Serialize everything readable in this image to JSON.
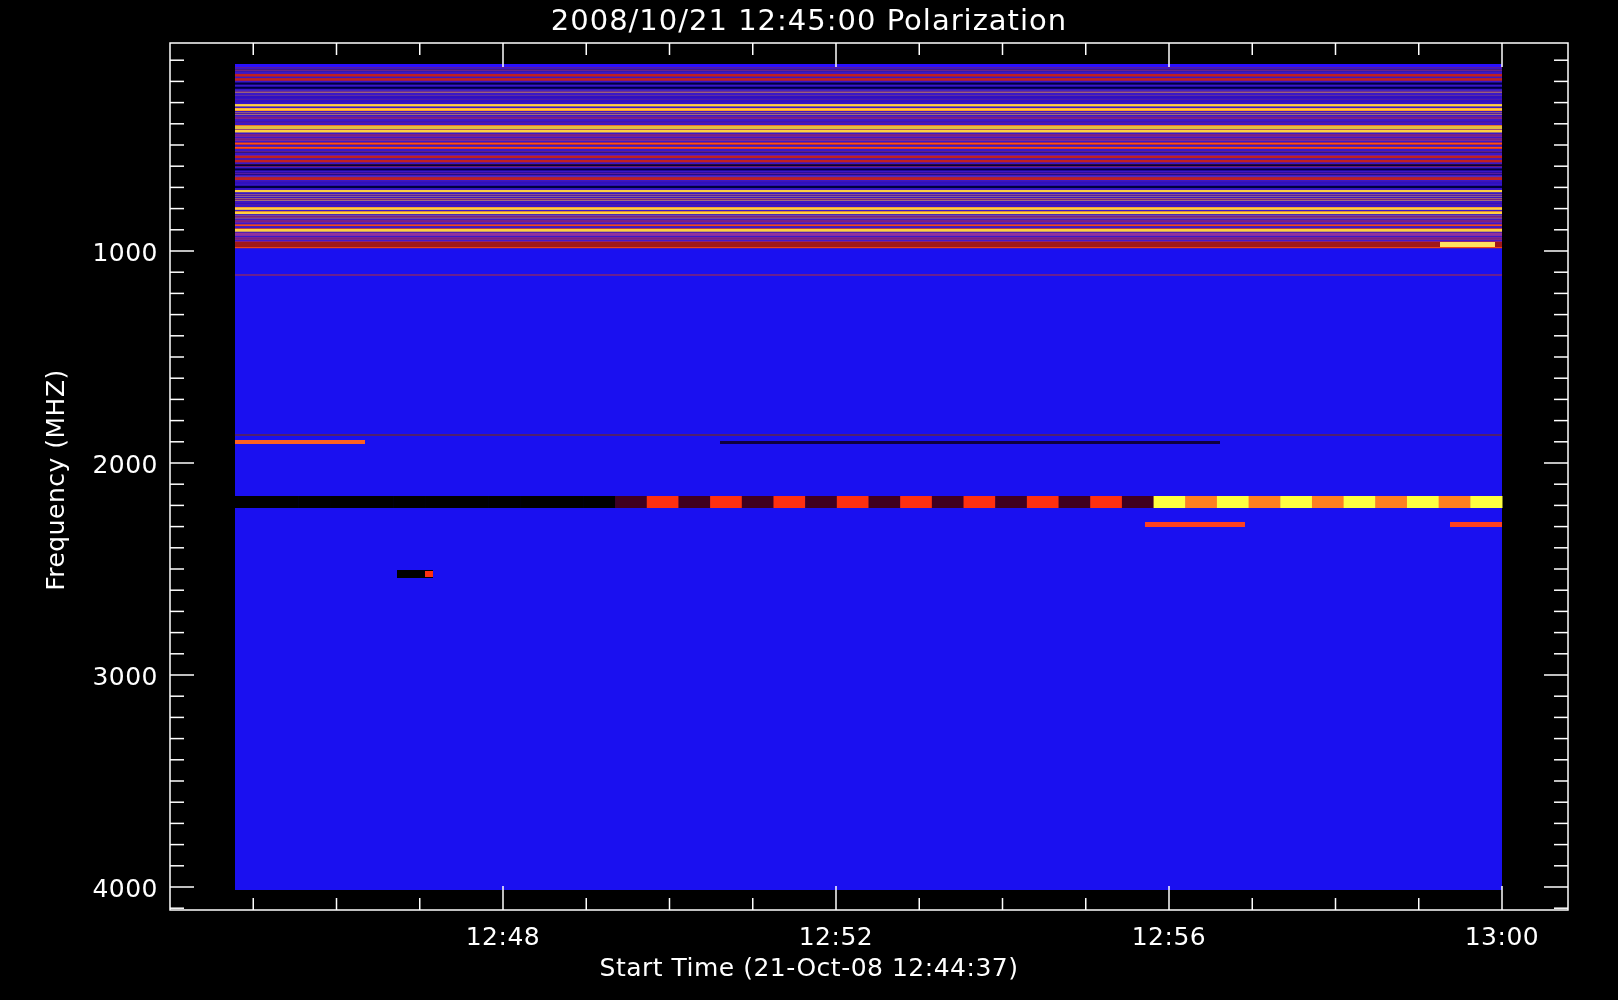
{
  "title": "2008/10/21 12:45:00 Polarization",
  "y_axis": {
    "label": "Frequency (MHZ)",
    "ticks": [
      "1000",
      "2000",
      "3000",
      "4000"
    ]
  },
  "x_axis": {
    "label": "Start Time (21-Oct-08 12:44:37)",
    "ticks": [
      "12:48",
      "12:52",
      "12:56",
      "13:00"
    ]
  }
}
